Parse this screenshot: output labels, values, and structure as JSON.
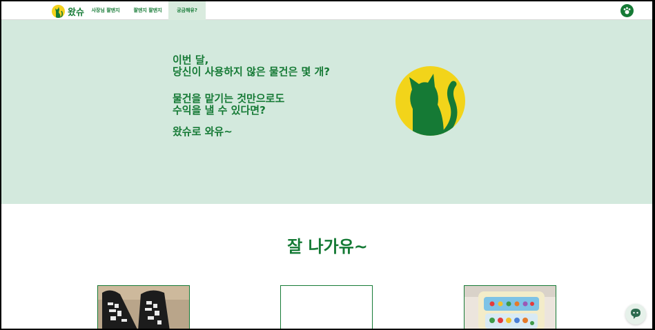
{
  "header": {
    "brand_name": "왔슈",
    "nav": [
      "사장님 팔덴지",
      "팔덴지 팔덴지",
      "궁금해유?"
    ],
    "profile_icon": "paw-icon"
  },
  "hero": {
    "line1": "이번 달,",
    "line2": "당신이 사용하지 않은 물건은 몇 개?",
    "line3": "물건을 맡기는 것만으로도",
    "line4": "수익을 낼 수 있다면?",
    "line5": "왔슈로 와유~",
    "illustration": "cat-logo"
  },
  "section": {
    "title": "잘 나가유~"
  },
  "cards": [
    {
      "image": "socks-photo"
    },
    {
      "image": "blank"
    },
    {
      "image": "toy-photo"
    }
  ],
  "chat": {
    "icon": "chat-icon"
  },
  "colors": {
    "brand_green": "#157a35",
    "hero_bg": "#d3e9dd",
    "logo_yellow": "#f2d41a"
  }
}
